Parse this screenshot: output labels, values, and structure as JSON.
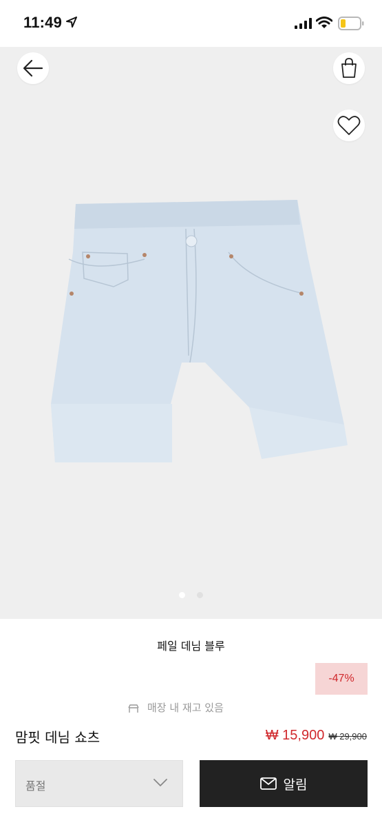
{
  "status_bar": {
    "time": "11:49"
  },
  "product": {
    "color": "페일 데님 블루",
    "discount": "-47%",
    "notice": "매장 내 재고 있음",
    "name": "맘핏 데님 쇼츠",
    "sale_price": "₩ 15,900",
    "original_price": "₩ 29,900"
  },
  "gallery": {
    "image_count": 2,
    "active_index": 0
  },
  "size_select": {
    "value": "품절"
  },
  "notify_button": {
    "label": "알림"
  },
  "colors": {
    "accent": "#d0282c",
    "badge_bg": "#f6d5d5",
    "button_dark": "#222222",
    "image_bg": "#efefef",
    "denim": "#d6e2ee"
  },
  "icons": [
    "location-arrow-icon",
    "signal-icon",
    "wifi-icon",
    "battery-icon",
    "back-arrow-icon",
    "shopping-bag-icon",
    "heart-icon",
    "chevron-down-icon",
    "mail-icon",
    "store-icon"
  ]
}
